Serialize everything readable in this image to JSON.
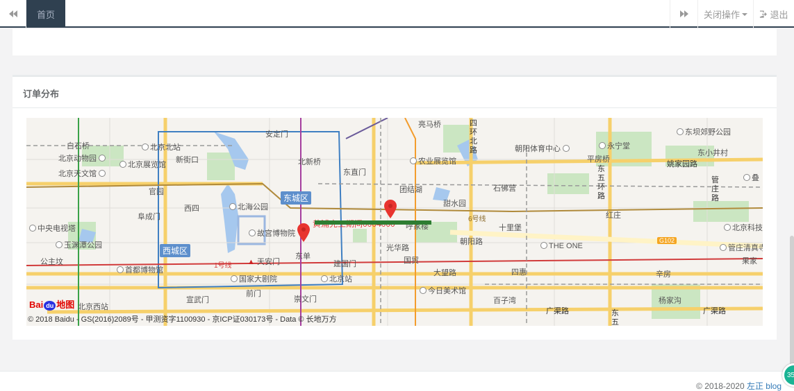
{
  "topbar": {
    "active_tab": "首页",
    "close_ops": "关闭操作",
    "logout": "退出"
  },
  "panel": {
    "title": "订单分布"
  },
  "map": {
    "districts": [
      "东城区",
      "西城区"
    ],
    "places": [
      {
        "label": "白石桥"
      },
      {
        "label": "北京北站"
      },
      {
        "label": "北京动物园"
      },
      {
        "label": "北京展览馆"
      },
      {
        "label": "新街口"
      },
      {
        "label": "北京天文馆"
      },
      {
        "label": "安定门"
      },
      {
        "label": "北新桥"
      },
      {
        "label": "东直门"
      },
      {
        "label": "亮马桥"
      },
      {
        "label": "农业展览馆"
      },
      {
        "label": "朝阳体育中心"
      },
      {
        "label": "永宁堂"
      },
      {
        "label": "东坝郊野公园"
      },
      {
        "label": "东小井村"
      },
      {
        "label": "平房桥"
      },
      {
        "label": "姚家园路"
      },
      {
        "label": "官园"
      },
      {
        "label": "团结湖"
      },
      {
        "label": "石佛营"
      },
      {
        "label": "管庄路"
      },
      {
        "label": "叠"
      },
      {
        "label": "阜成门"
      },
      {
        "label": "西四"
      },
      {
        "label": "北海公园"
      },
      {
        "label": "甜水园"
      },
      {
        "label": "红庄"
      },
      {
        "label": "中央电视塔"
      },
      {
        "label": "故宫博物院"
      },
      {
        "label": "十里堡"
      },
      {
        "label": "北京科技"
      },
      {
        "label": "玉渊潭公园"
      },
      {
        "label": "朝阳路"
      },
      {
        "label": "东单"
      },
      {
        "label": "光华路"
      },
      {
        "label": "管庄清真寺"
      },
      {
        "label": "公主坟"
      },
      {
        "label": "首都博物馆"
      },
      {
        "label": "天安门"
      },
      {
        "label": "建国门"
      },
      {
        "label": "国贸"
      },
      {
        "label": "THE ONE"
      },
      {
        "label": "果家"
      },
      {
        "label": "国家大剧院"
      },
      {
        "label": "北京站"
      },
      {
        "label": "大望路"
      },
      {
        "label": "四惠"
      },
      {
        "label": "辛房"
      },
      {
        "label": "前门"
      },
      {
        "label": "今日美术馆"
      },
      {
        "label": "北京西站"
      },
      {
        "label": "宣武门"
      },
      {
        "label": "崇文门"
      },
      {
        "label": "百子湾"
      },
      {
        "label": "广渠路"
      },
      {
        "label": "杨家沟"
      },
      {
        "label": "广渠路"
      },
      {
        "label": "1号线"
      },
      {
        "label": "6号线"
      },
      {
        "label": "G102"
      },
      {
        "label": "呼家楼"
      }
    ],
    "road_labels": [
      "四环北路",
      "东五环路",
      "东五"
    ],
    "marker_caption": "黄浦完工期间0004000",
    "baidu_logo": [
      "Bai",
      "du",
      "地图"
    ],
    "copyright": "© 2018 Baidu - GS(2016)2089号 - 甲测资字1100930 - 京ICP证030173号 - Data © 长地万方"
  },
  "footer": {
    "copyright": "© 2018-2020 ",
    "link": "左正 blog"
  },
  "badge": "35"
}
